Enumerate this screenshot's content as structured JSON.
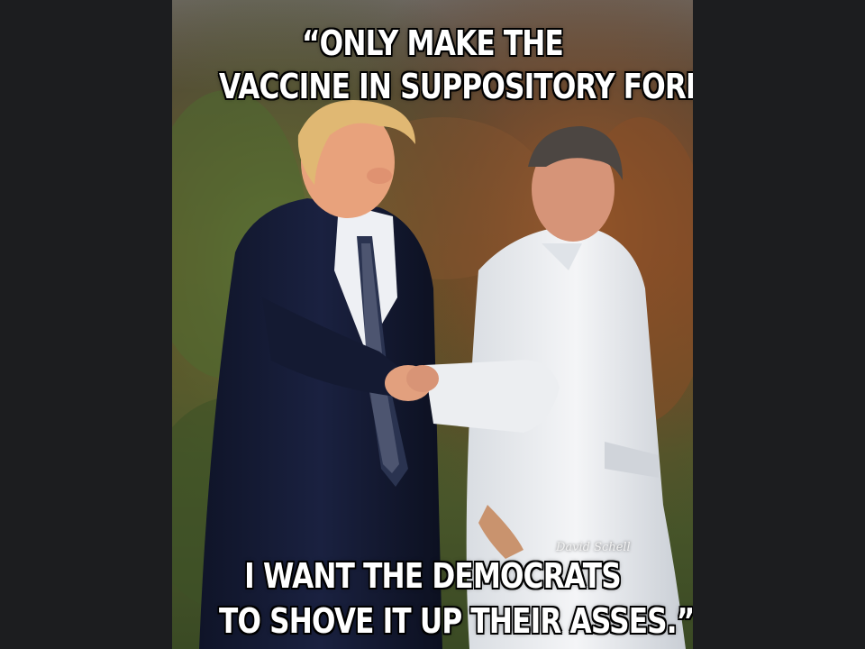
{
  "meme": {
    "top_caption": {
      "line1": "“ONLY MAKE THE",
      "line2": "VACCINE IN SUPPOSITORY FORM."
    },
    "bottom_caption": {
      "line1": "I WANT THE DEMOCRATS",
      "line2": "TO SHOVE IT UP THEIR ASSES.”"
    },
    "watermark": "David Schell"
  },
  "colors": {
    "viewer_background": "#1c1d1f",
    "caption_text": "#ffffff",
    "caption_outline": "#000000"
  }
}
